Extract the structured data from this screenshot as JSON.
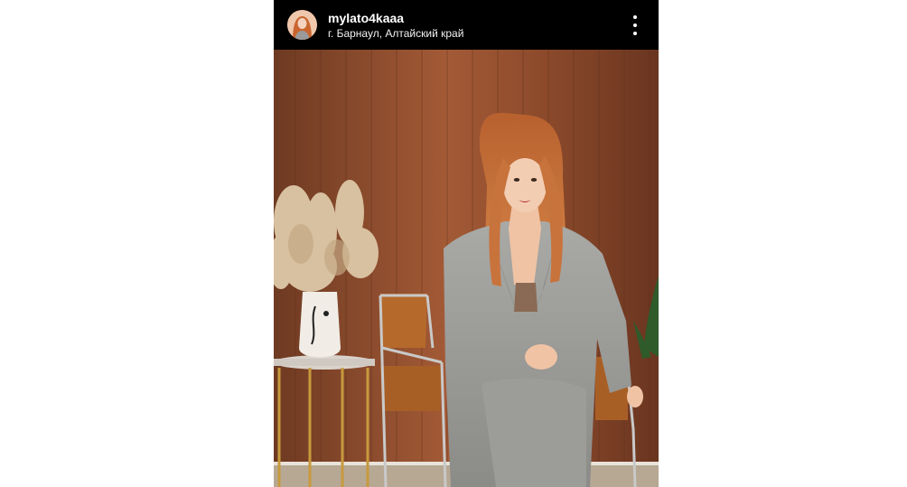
{
  "post": {
    "header": {
      "username": "mylato4kaaa",
      "location": "г. Барнаул, Алтайский край"
    },
    "photo": {
      "subject": "woman-in-grey-suit-seated"
    }
  },
  "icons": {
    "more": "more-vertical-icon",
    "avatar": "profile-avatar"
  },
  "colors": {
    "header_bg": "#000000",
    "text": "#ffffff",
    "wall": "#8a4a2c"
  }
}
